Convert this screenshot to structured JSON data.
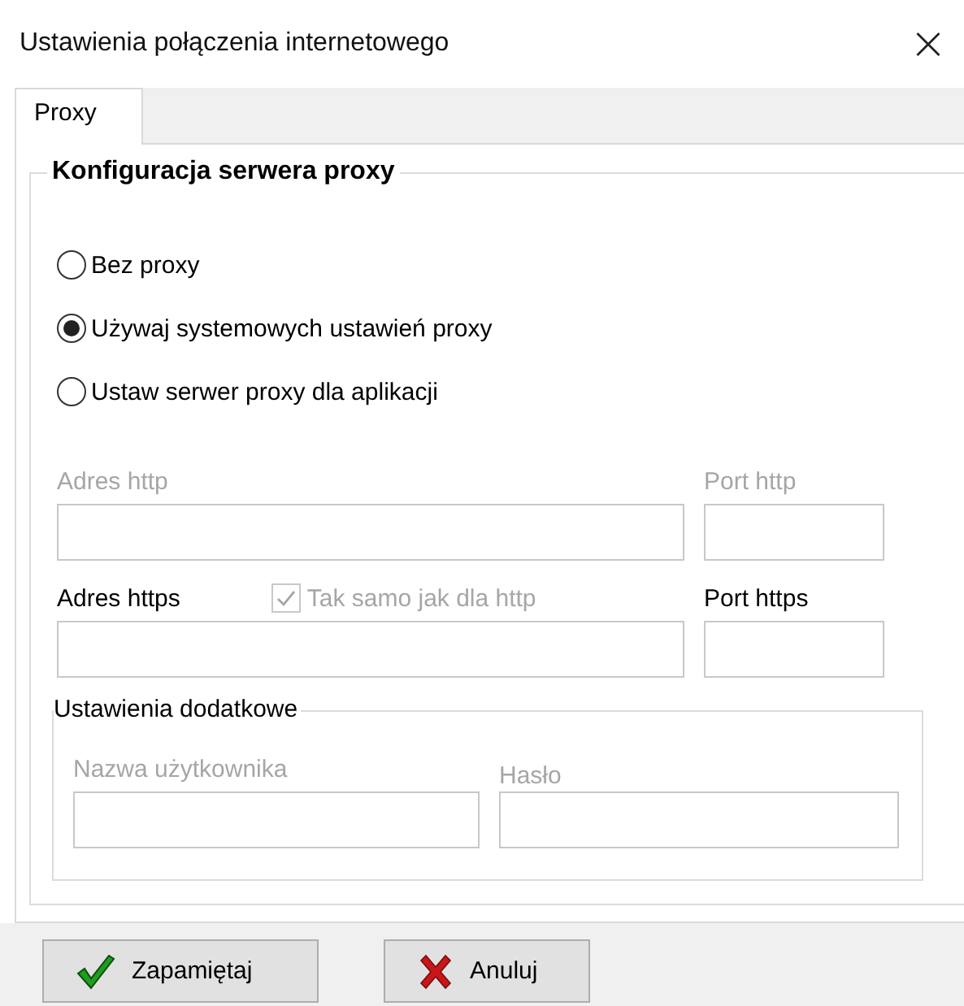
{
  "window": {
    "title": "Ustawienia połączenia internetowego",
    "close": "×"
  },
  "tabs": [
    {
      "label": "Proxy",
      "selected": true
    }
  ],
  "group": {
    "title": "Konfiguracja serwera proxy"
  },
  "radios": [
    {
      "label": "Bez proxy",
      "selected": false
    },
    {
      "label": "Używaj systemowych ustawień proxy",
      "selected": true
    },
    {
      "label": "Ustaw serwer proxy dla aplikacji",
      "selected": false
    }
  ],
  "http": {
    "address_label": "Adres http",
    "port_label": "Port http",
    "disabled": true
  },
  "https": {
    "address_label": "Adres https",
    "port_label": "Port https",
    "disabled": false,
    "same": {
      "label": "Tak samo jak dla http",
      "checked": true,
      "disabled": true
    }
  },
  "extra": {
    "title": "Ustawienia dodatkowe",
    "user_label": "Nazwa użytkownika",
    "password_label": "Hasło",
    "disabled": true
  },
  "buttons": [
    {
      "kind": "save",
      "label": "Zapamiętaj"
    },
    {
      "kind": "cancel",
      "label": "Anuluj"
    }
  ]
}
